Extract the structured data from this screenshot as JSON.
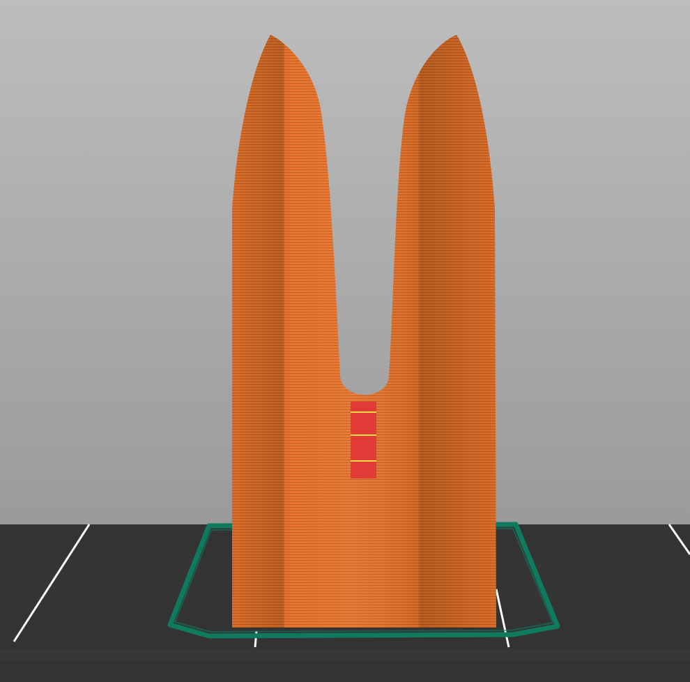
{
  "viewport": {
    "view": "3d-gcode-preview",
    "colors": {
      "background_top": "#bdbdbd",
      "background_bottom": "#9a9a9a",
      "bed": "#333333",
      "bed_band": "#3a3a3a",
      "bed_grid_line": "#ffffff",
      "skirt": "#0f7a5e",
      "perimeter": "#e8752c",
      "perimeter_shadow": "#b4581e",
      "perimeter_highlight": "#f39a55",
      "layer_line": "#9e4916",
      "top_infill": "#e23a36",
      "travel_marker": "#f0e040"
    }
  }
}
